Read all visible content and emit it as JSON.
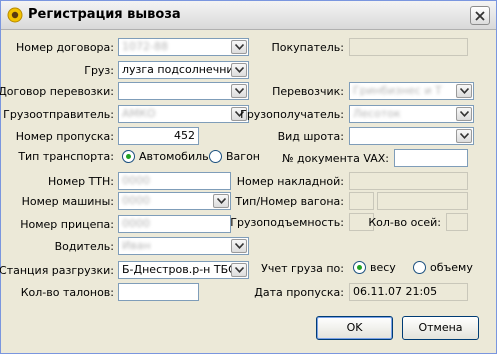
{
  "window": {
    "title": "Регистрация вывоза",
    "app_icon": "sunflower-icon",
    "close_icon": "close-icon"
  },
  "form": {
    "contract_number": {
      "label": "Номер договора:",
      "value": "1072-88"
    },
    "cargo": {
      "label": "Груз:",
      "value": "лузга подсолнечника"
    },
    "transport_contract": {
      "label": "Договор перевозки:",
      "value": ""
    },
    "shipper": {
      "label": "Грузоотправитель:",
      "value": "АМКО"
    },
    "pass_number": {
      "label": "Номер пропуска:",
      "value": "452"
    },
    "transport_type": {
      "label": "Тип транспорта:",
      "options": [
        "Автомобиль",
        "Вагон"
      ],
      "selected": "Автомобиль"
    },
    "ttn_number": {
      "label": "Номер ТТН:",
      "value": "0000"
    },
    "car_number": {
      "label": "Номер машины:",
      "value": "0000"
    },
    "trailer_number": {
      "label": "Номер прицепа:",
      "value": "0000"
    },
    "driver": {
      "label": "Водитель:",
      "value": "Иван"
    },
    "unload_station": {
      "label": "Станция разгрузки:",
      "value": "Б-Днестров.р-н ТБО"
    },
    "coupons_count": {
      "label": "Кол-во талонов:",
      "value": ""
    },
    "buyer": {
      "label": "Покупатель:",
      "value": ""
    },
    "carrier": {
      "label": "Перевозчик:",
      "value": "Гринбизнес и Т"
    },
    "consignee": {
      "label": "Грузополучатель:",
      "value": "Лесоток"
    },
    "meal_type": {
      "label": "Вид шрота:",
      "value": ""
    },
    "vax_doc": {
      "label": "№ документа VAX:",
      "value": ""
    },
    "waybill_number": {
      "label": "Номер накладной:",
      "value": ""
    },
    "wagon_type_number": {
      "label": "Тип/Номер вагона:",
      "value1": "",
      "value2": ""
    },
    "capacity": {
      "label": "Грузоподъемность:",
      "value": ""
    },
    "axles": {
      "label": "Кол-во осей:",
      "value": ""
    },
    "cargo_accounting": {
      "label": "Учет груза по:",
      "options": [
        "весу",
        "объему"
      ],
      "selected": "весу"
    },
    "pass_date": {
      "label": "Дата пропуска:",
      "value": "06.11.07 21:05"
    }
  },
  "buttons": {
    "ok": "OK",
    "cancel": "Отмена"
  },
  "colors": {
    "radio_dot": "#21a121",
    "dialog_bg": "#ece9d8",
    "input_border": "#7f9db9"
  }
}
